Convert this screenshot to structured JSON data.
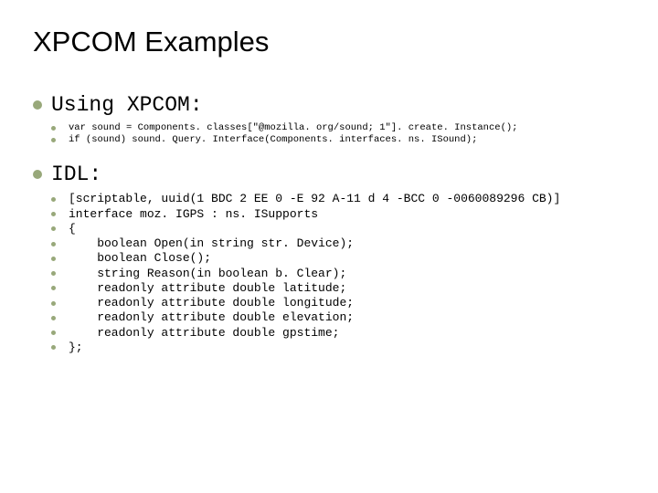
{
  "title": "XPCOM Examples",
  "section1": {
    "heading": "Using XPCOM:",
    "lines": {
      "l0": "var sound = Components. classes[\"@mozilla. org/sound; 1\"]. create. Instance();",
      "l1": "if (sound) sound. Query. Interface(Components. interfaces. ns. ISound);"
    }
  },
  "section2": {
    "heading": "IDL:",
    "lines": {
      "l0": "[scriptable, uuid(1 BDC 2 EE 0 -E 92 A-11 d 4 -BCC 0 -0060089296 CB)]",
      "l1": "interface moz. IGPS : ns. ISupports",
      "l2": "{",
      "l3": "    boolean Open(in string str. Device);",
      "l4": "    boolean Close();",
      "l5": "    string Reason(in boolean b. Clear);",
      "l6": "    readonly attribute double latitude;",
      "l7": "    readonly attribute double longitude;",
      "l8": "    readonly attribute double elevation;",
      "l9": "    readonly attribute double gpstime;",
      "l10": "};"
    }
  }
}
